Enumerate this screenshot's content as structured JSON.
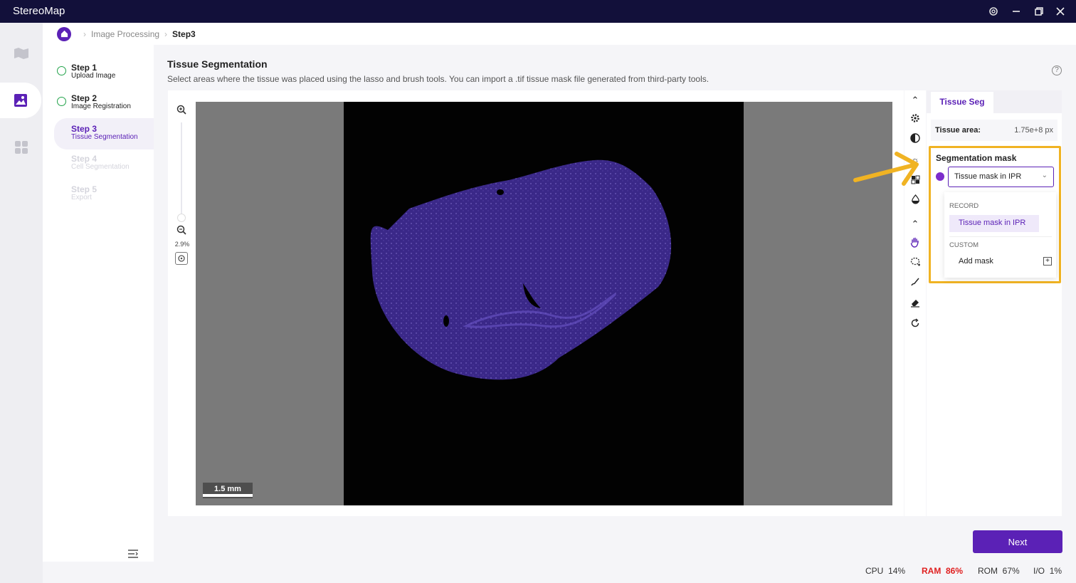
{
  "window": {
    "title": "StereoMap"
  },
  "breadcrumb": {
    "parent": "Image Processing",
    "current": "Step3"
  },
  "steps": [
    {
      "title": "Step 1",
      "subtitle": "Upload Image",
      "state": "done"
    },
    {
      "title": "Step 2",
      "subtitle": "Image Registration",
      "state": "done"
    },
    {
      "title": "Step 3",
      "subtitle": "Tissue Segmentation",
      "state": "active"
    },
    {
      "title": "Step 4",
      "subtitle": "Cell Segmentation",
      "state": "pending"
    },
    {
      "title": "Step 5",
      "subtitle": "Export",
      "state": "pending"
    }
  ],
  "section": {
    "title": "Tissue Segmentation",
    "description": "Select areas where the tissue was placed using the lasso and brush tools. You can import a .tif tissue mask file generated from third-party tools."
  },
  "viewer": {
    "zoom_level": "2.9%",
    "scale_label": "1.5 mm"
  },
  "right_panel": {
    "tab": "Tissue Seg",
    "tissue_area_label": "Tissue area:",
    "tissue_area_value": "1.75e+8 px",
    "seg_mask_label": "Segmentation mask",
    "mask_color": "#7c2ccc",
    "selected_mask": "Tissue mask in IPR",
    "dropdown": {
      "group_record": "RECORD",
      "record_item": "Tissue mask in IPR",
      "group_custom": "CUSTOM",
      "add_item": "Add mask"
    }
  },
  "actions": {
    "next": "Next"
  },
  "status": {
    "cpu_label": "CPU",
    "cpu": "14%",
    "ram_label": "RAM",
    "ram": "86%",
    "rom_label": "ROM",
    "rom": "67%",
    "io_label": "I/O",
    "io": "1%"
  },
  "colors": {
    "accent": "#5b21b6",
    "highlight": "#f0b323",
    "tissue": "#3b2a8a"
  }
}
